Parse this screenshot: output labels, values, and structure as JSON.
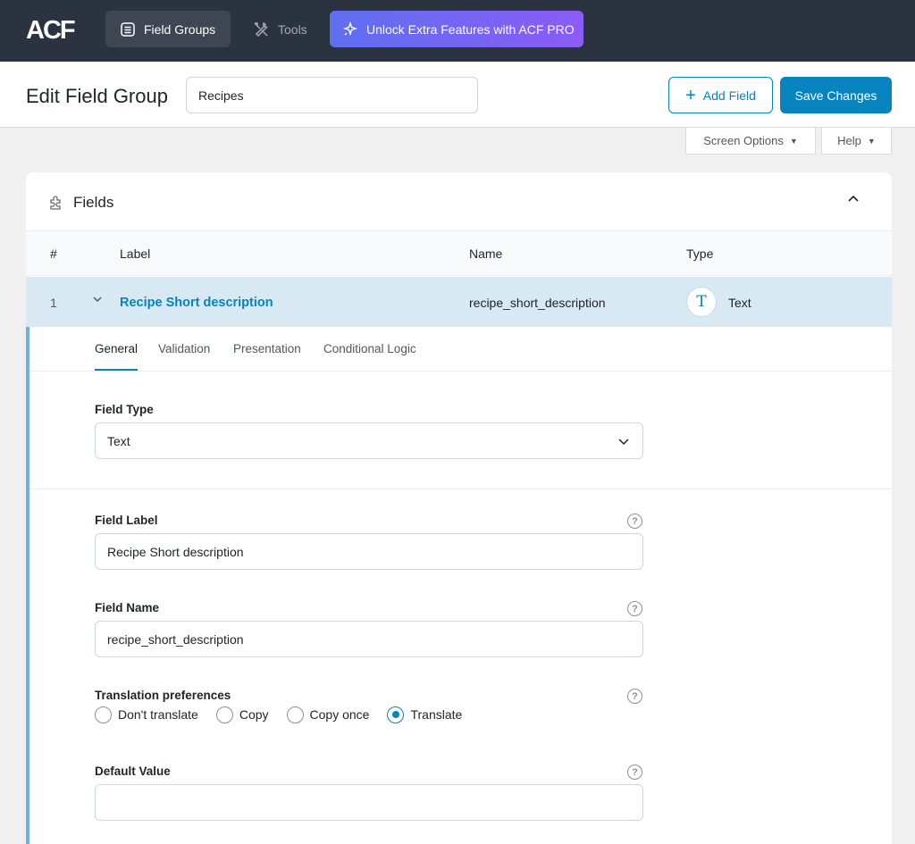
{
  "topbar": {
    "logo": "ACF",
    "field_groups_label": "Field Groups",
    "tools_label": "Tools",
    "pro_label": "Unlock Extra Features with ACF PRO"
  },
  "header": {
    "title": "Edit Field Group",
    "group_name_value": "Recipes",
    "add_field_label": "Add Field",
    "save_label": "Save Changes",
    "screen_options_label": "Screen Options",
    "help_label": "Help"
  },
  "fields_card": {
    "title": "Fields",
    "columns": [
      "#",
      "Label",
      "Name",
      "Type"
    ],
    "row": {
      "num": "1",
      "label": "Recipe Short description",
      "name": "recipe_short_description",
      "type_icon": "T",
      "type": "Text"
    },
    "tabs": [
      "General",
      "Validation",
      "Presentation",
      "Conditional Logic"
    ],
    "active_tab": "General"
  },
  "settings": {
    "field_type_label": "Field Type",
    "field_type_value": "Text",
    "field_label_label": "Field Label",
    "field_label_value": "Recipe Short description",
    "field_name_label": "Field Name",
    "field_name_value": "recipe_short_description",
    "translation_label": "Translation preferences",
    "translation_options": [
      "Don't translate",
      "Copy",
      "Copy once",
      "Translate"
    ],
    "translation_selected": "Translate",
    "default_value_label": "Default Value",
    "default_value_value": "",
    "help_glyph": "?"
  },
  "colors": {
    "topbar_bg": "#2c3340",
    "accent": "#0783be",
    "row_highlight": "#d9e9f3",
    "left_border": "#72aee6"
  }
}
